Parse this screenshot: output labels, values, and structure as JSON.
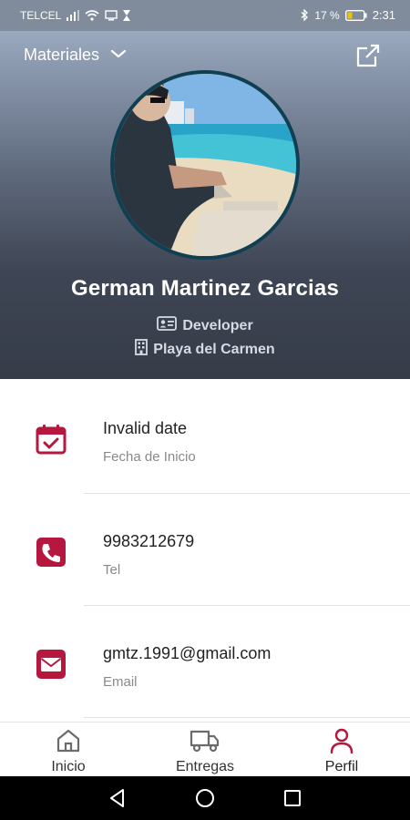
{
  "status_bar": {
    "carrier": "TELCEL",
    "battery_percent": "17 %",
    "time": "2:31"
  },
  "header": {
    "selector_label": "Materiales",
    "selector_icon": "chevron-down-icon",
    "external_icon": "external-link-icon"
  },
  "profile": {
    "name": "German Martinez Garcias",
    "role": "Developer",
    "location": "Playa del Carmen"
  },
  "info_items": [
    {
      "value": "Invalid date",
      "label": "Fecha de Inicio",
      "icon": "calendar-check-icon"
    },
    {
      "value": "9983212679",
      "label": "Tel",
      "icon": "phone-icon"
    },
    {
      "value": "gmtz.1991@gmail.com",
      "label": "Email",
      "icon": "mail-icon"
    }
  ],
  "bottom_nav": {
    "items": [
      {
        "label": "Inicio",
        "icon": "home-icon",
        "active": false
      },
      {
        "label": "Entregas",
        "icon": "truck-icon",
        "active": false
      },
      {
        "label": "Perfil",
        "icon": "user-icon",
        "active": true
      }
    ]
  },
  "colors": {
    "accent": "#b5173f",
    "header_dark": "#363c48",
    "header_light": "#a9b8cc"
  }
}
